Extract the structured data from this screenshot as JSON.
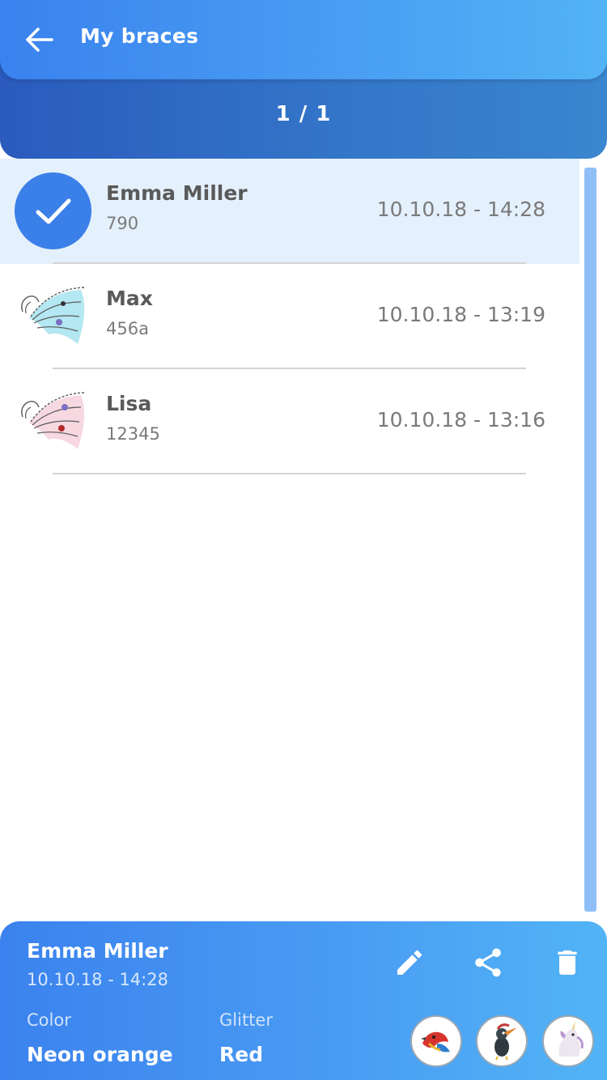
{
  "header": {
    "title": "My braces",
    "pager": "1 / 1"
  },
  "list": {
    "items": [
      {
        "name": "Emma Miller",
        "code": "790",
        "datetime": "10.10.18 - 14:28",
        "selected": true
      },
      {
        "name": "Max",
        "code": "456a",
        "datetime": "10.10.18 - 13:19",
        "selected": false,
        "thumb_tint": "#a6e3ef"
      },
      {
        "name": "Lisa",
        "code": "12345",
        "datetime": "10.10.18 - 13:16",
        "selected": false,
        "thumb_tint": "#f6d4de"
      }
    ]
  },
  "detail": {
    "name": "Emma Miller",
    "datetime": "10.10.18 - 14:28",
    "color_label": "Color",
    "color_value": "Neon orange",
    "glitter_label": "Glitter",
    "glitter_value": "Red",
    "actions": [
      "edit-icon",
      "share-icon",
      "trash-icon"
    ],
    "stickers": [
      "parrot-sticker",
      "bird-sticker",
      "unicorn-sticker"
    ]
  },
  "colors": {
    "accent": "#3b7fe8",
    "selected_row": "#e4f0fc",
    "scrollbar": "#8fbff6"
  }
}
